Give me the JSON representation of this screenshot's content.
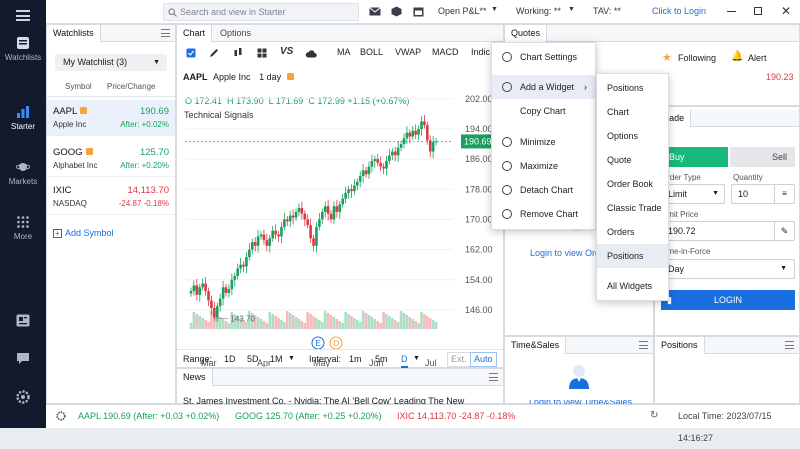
{
  "rail": {
    "items": [
      {
        "label": "Watchlists",
        "icon": "watchlist-icon"
      },
      {
        "label": "Starter",
        "icon": "bar-chart-icon"
      },
      {
        "label": "Markets",
        "icon": "planet-icon"
      },
      {
        "label": "More",
        "icon": "grid-icon"
      }
    ],
    "bottom_icons": [
      "news-icon",
      "chat-icon",
      "settings-icon"
    ]
  },
  "topbar": {
    "search_placeholder": "Search and view in Starter",
    "open_pl": "Open P&L**",
    "working": "Working: **",
    "tav": "TAV: **",
    "login_link": "Click to Login"
  },
  "watchlist": {
    "tab": "Watchlists",
    "dropdown": "My Watchlist (3)",
    "col_symbol": "Symbol",
    "col_price": "Price/Change",
    "rows": [
      {
        "symbol": "AAPL",
        "name": "Apple Inc",
        "price": "190.69",
        "change": "After: +0.02%",
        "dir": "up"
      },
      {
        "symbol": "GOOG",
        "name": "Alphabet Inc",
        "price": "125.70",
        "change": "After: +0.20%",
        "dir": "up"
      },
      {
        "symbol": "IXIC",
        "name": "NASDAQ",
        "price": "14,113.70",
        "change": "-24.87 -0.18%",
        "dir": "dn"
      }
    ],
    "add_symbol": "Add Symbol"
  },
  "chart": {
    "tabs": [
      "Chart",
      "Options"
    ],
    "toolbar": [
      "MA",
      "BOLL",
      "VWAP",
      "MACD",
      "Indic"
    ],
    "symbol": "AAPL",
    "company": "Apple Inc",
    "period": "1 day",
    "ohlc": {
      "o": "172.41",
      "h": "173.90",
      "l": "171.69",
      "c": "172.99",
      "chg": "+1.15 (+0.67%)"
    },
    "signals": "Technical Signals",
    "last_price": "190.69",
    "low_marker": "143.70",
    "range_label": "Range:",
    "ranges": [
      "1D",
      "5D",
      "1M"
    ],
    "interval_label": "Interval:",
    "intervals": [
      "1m",
      "5m",
      "D"
    ],
    "ext": "Ext.",
    "auto": "Auto"
  },
  "chart_data": {
    "type": "candlestick",
    "x_labels": [
      "Mar",
      "Apr",
      "May",
      "Jun",
      "Jul"
    ],
    "y_ticks": [
      "202.00",
      "194.00",
      "186.00",
      "178.00",
      "170.00",
      "162.00",
      "154.00",
      "146.00"
    ],
    "ylim": [
      142,
      203
    ],
    "closes": [
      151,
      152.5,
      150,
      152,
      153,
      151,
      148.5,
      146.5,
      144,
      147,
      149,
      152,
      150.5,
      151.5,
      154,
      155,
      157,
      158,
      157.5,
      160,
      162,
      164,
      163,
      165.5,
      166,
      164.5,
      163,
      165,
      167,
      166,
      165.5,
      168,
      170,
      169.5,
      171,
      170.5,
      172,
      173,
      171.5,
      170,
      168.5,
      165,
      163,
      168,
      170,
      172,
      173.5,
      171.5,
      170,
      173.5,
      172,
      174,
      175.5,
      177,
      178,
      177.5,
      179,
      180,
      181.5,
      183,
      182,
      184,
      185.5,
      186,
      185,
      184,
      183.5,
      185.5,
      187,
      188,
      187,
      189,
      190,
      191.5,
      193,
      192,
      193.5,
      192.5,
      194,
      196,
      195,
      191,
      188,
      190.5,
      190.69
    ]
  },
  "context_menu": {
    "items": [
      "Chart Settings",
      "Add a Widget",
      "Copy Chart",
      "Minimize",
      "Maximize",
      "Detach Chart",
      "Remove Chart"
    ],
    "submenu": [
      "Positions",
      "Chart",
      "Options",
      "Quote",
      "Order Book",
      "Classic Trade",
      "Orders",
      "Positions",
      "All Widgets"
    ]
  },
  "quotes": {
    "tab": "Quotes",
    "following": "Following",
    "alert": "Alert",
    "price": "190.23",
    "login_text": "Login to view Orders"
  },
  "trade": {
    "tab": "Trade",
    "buy": "Buy",
    "sell": "Sell",
    "order_type_label": "Order Type",
    "order_type": "Limit",
    "quantity_label": "Quantity",
    "quantity": "10",
    "limit_price_label": "Limit Price",
    "limit_price": "190.72",
    "tif_label": "Time-in-Force",
    "tif": "Day",
    "login_button": "LOGIN"
  },
  "news": {
    "tab": "News",
    "headline": "St. James Investment Co. - Nvidia: The AI 'Bell Cow' Leading The New"
  },
  "time_sales": {
    "tab": "Time&Sales",
    "login_text": "Login to view Time&Sales"
  },
  "positions": {
    "tab": "Positions"
  },
  "ticker": [
    {
      "text": "AAPL 190.69 (After: +0.03 +0.02%)",
      "dir": "up"
    },
    {
      "text": "GOOG 125.70 (After: +0.25 +0.20%)",
      "dir": "up"
    },
    {
      "text": "IXIC 14,113.70 -24.87 -0.18%",
      "dir": "dn"
    }
  ],
  "local_time": "Local Time: 2023/07/15 14:16:27",
  "colors": {
    "up": "#18a05c",
    "down": "#e0383f",
    "accent": "#1a6fe0",
    "buy": "#18b97a"
  }
}
